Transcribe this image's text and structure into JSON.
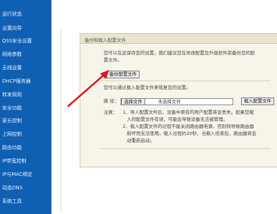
{
  "sidebar": {
    "items": [
      {
        "label": "运行状态"
      },
      {
        "label": "设置向导"
      },
      {
        "label": "QSS安全设置"
      },
      {
        "label": "网络参数"
      },
      {
        "label": "无线设置"
      },
      {
        "label": "DHCP服务器"
      },
      {
        "label": "转发规则"
      },
      {
        "label": "安全功能"
      },
      {
        "label": "家长控制"
      },
      {
        "label": "上网控制"
      },
      {
        "label": "路由功能"
      },
      {
        "label": "IP带宽控制"
      },
      {
        "label": "IP与MAC绑定"
      },
      {
        "label": "动态DNS"
      },
      {
        "label": "系统工具"
      }
    ]
  },
  "panel": {
    "title": "备份和载入配置文件",
    "intro_line1": "您可以在这保存您的设置，我们建议您在修改配置及升级软件前备份您的配",
    "intro_line2": "置文件。",
    "backup_button": "备份配置文件",
    "load_hint": "您可以通过载入配置文件来恢复您的设置。",
    "path_label": "路  径：",
    "choose_button": "选择文件",
    "no_file_text": "未选择文件",
    "load_button": "载入配置文件",
    "note_label": "注意：",
    "note_line1": "1、导入配置文件后，设备中原有的用户配置将会丢失。如果您载",
    "note_line2": "入的配置文件有误，可能会导致设备无法被管理。",
    "note_line3": "2、载入配置文件的过程不能关闭路由器电源，否则将导致路由器",
    "note_line4": "损坏而无法使用。载入过程约20秒，当载入结束后，路由器将会",
    "note_line5": "动重新启动。"
  },
  "colors": {
    "sidebar_bg": "#0f5fb3",
    "annotation_arrow": "#d81818"
  }
}
